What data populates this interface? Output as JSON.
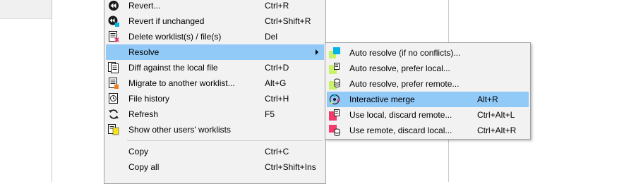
{
  "main_menu": {
    "items": [
      {
        "label": "Revert...",
        "shortcut": "Ctrl+R",
        "icon": "revert-icon"
      },
      {
        "label": "Revert if unchanged",
        "shortcut": "Ctrl+Shift+R",
        "icon": "revert-if-unchanged-icon"
      },
      {
        "label": "Delete worklist(s) / file(s)",
        "shortcut": "Del",
        "icon": "delete-worklist-icon"
      },
      {
        "label": "Resolve",
        "shortcut": "",
        "icon": "",
        "has_submenu": true,
        "highlighted": true
      },
      {
        "label": "Diff against the local file",
        "shortcut": "Ctrl+D",
        "icon": "diff-icon"
      },
      {
        "label": "Migrate to another worklist...",
        "shortcut": "Alt+G",
        "icon": "migrate-icon"
      },
      {
        "label": "File history",
        "shortcut": "Ctrl+H",
        "icon": "history-icon"
      },
      {
        "label": "Refresh",
        "shortcut": "F5",
        "icon": "refresh-icon"
      },
      {
        "label": "Show other users' worklists",
        "shortcut": "",
        "icon": "other-users-worklists-icon"
      },
      {
        "label": "Copy",
        "shortcut": "Ctrl+C",
        "icon": ""
      },
      {
        "label": "Copy all",
        "shortcut": "Ctrl+Shift+Ins",
        "icon": ""
      }
    ]
  },
  "resolve_submenu": {
    "items": [
      {
        "label": "Auto resolve (if no conflicts)...",
        "shortcut": "",
        "icon": "auto-resolve-icon"
      },
      {
        "label": "Auto resolve, prefer local...",
        "shortcut": "",
        "icon": "auto-resolve-local-icon"
      },
      {
        "label": "Auto resolve, prefer remote...",
        "shortcut": "",
        "icon": "auto-resolve-remote-icon"
      },
      {
        "label": "Interactive merge",
        "shortcut": "Alt+R",
        "icon": "interactive-merge-icon",
        "highlighted": true
      },
      {
        "label": "Use local, discard remote...",
        "shortcut": "Ctrl+Alt+L",
        "icon": "use-local-icon"
      },
      {
        "label": "Use remote, discard local...",
        "shortcut": "Ctrl+Alt+R",
        "icon": "use-remote-icon"
      }
    ]
  },
  "colors": {
    "highlight": "#91c9f7",
    "menu_bg": "#f2f2f2",
    "cyan": "#00b4e6",
    "lime": "#c9f266",
    "pink": "#f23a6b"
  }
}
